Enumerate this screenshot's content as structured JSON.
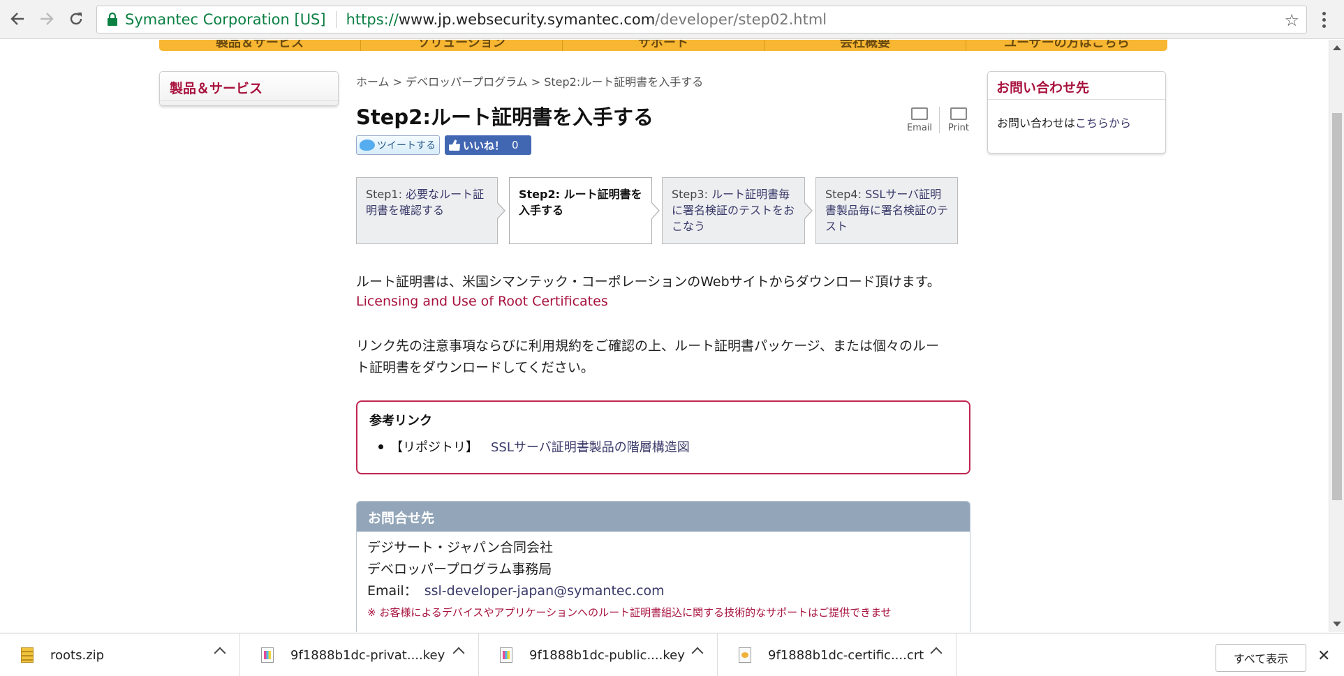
{
  "browser": {
    "secure_label": "Symantec Corporation [US]",
    "url_scheme": "https://",
    "url_host": "www.jp.websecurity.symantec.com",
    "url_path": "/developer/step02.html",
    "icons": [
      "back-icon",
      "forward-icon",
      "reload-icon",
      "lock-icon",
      "star-icon",
      "menu-icon"
    ]
  },
  "global_nav": {
    "items": [
      "製品＆サービス",
      "ソリューション",
      "サポート",
      "会社概要",
      "ユーザーの方はこちら"
    ]
  },
  "left_panel": {
    "title": "製品＆サービス"
  },
  "breadcrumb": "ホーム > デベロッパープログラム > Step2:ルート証明書を入手する",
  "page_title": "Step2:ルート証明書を入手する",
  "tools": {
    "email": "Email",
    "print": "Print"
  },
  "social": {
    "tweet": "ツイートする",
    "like": "いいね！",
    "like_count": "0"
  },
  "steps": [
    {
      "prefix": "Step1: ",
      "link": "必要なルート証明書を確認する"
    },
    {
      "prefix": "Step2: ",
      "text": "ルート証明書を入手する"
    },
    {
      "prefix": "Step3: ",
      "link": "ルート証明書毎に署名検証のテストをおこなう"
    },
    {
      "prefix": "Step4: ",
      "link": "SSLサーバ証明書製品毎に署名検証のテスト"
    }
  ],
  "content": {
    "intro": "ルート証明書は、米国シマンテック・コーポレーションのWebサイトからダウンロード頂けます。",
    "root_link": "Licensing and Use of Root Certificates",
    "instruction_line1": "リンク先の注意事項ならびに利用規約をご確認の上、ルート証明書パッケージ、または個々のルー",
    "instruction_line2": "ト証明書をダウンロードしてください。"
  },
  "reference": {
    "title": "参考リンク",
    "item_label": "【リポジトリ】",
    "item_link": "SSLサーバ証明書製品の階層構造図"
  },
  "contact": {
    "title": "お問合せ先",
    "company": "デジサート・ジャパン合同会社",
    "office": "デベロッパープログラム事務局",
    "email_label": "Email：",
    "email": "ssl-developer-japan@symantec.com",
    "note": "※ お客様によるデバイスやアプリケーションへのルート証明書組込に関する技術的なサポートはご提供できませ"
  },
  "right_panel": {
    "title": "お問い合わせ先",
    "text": "お問い合わせは",
    "link": "こちらから"
  },
  "downloads": {
    "files": [
      "roots.zip",
      "9f1888b1dc-privat....key",
      "9f1888b1dc-public....key",
      "9f1888b1dc-certific....crt"
    ],
    "show_all": "すべて表示",
    "close": "✕"
  }
}
